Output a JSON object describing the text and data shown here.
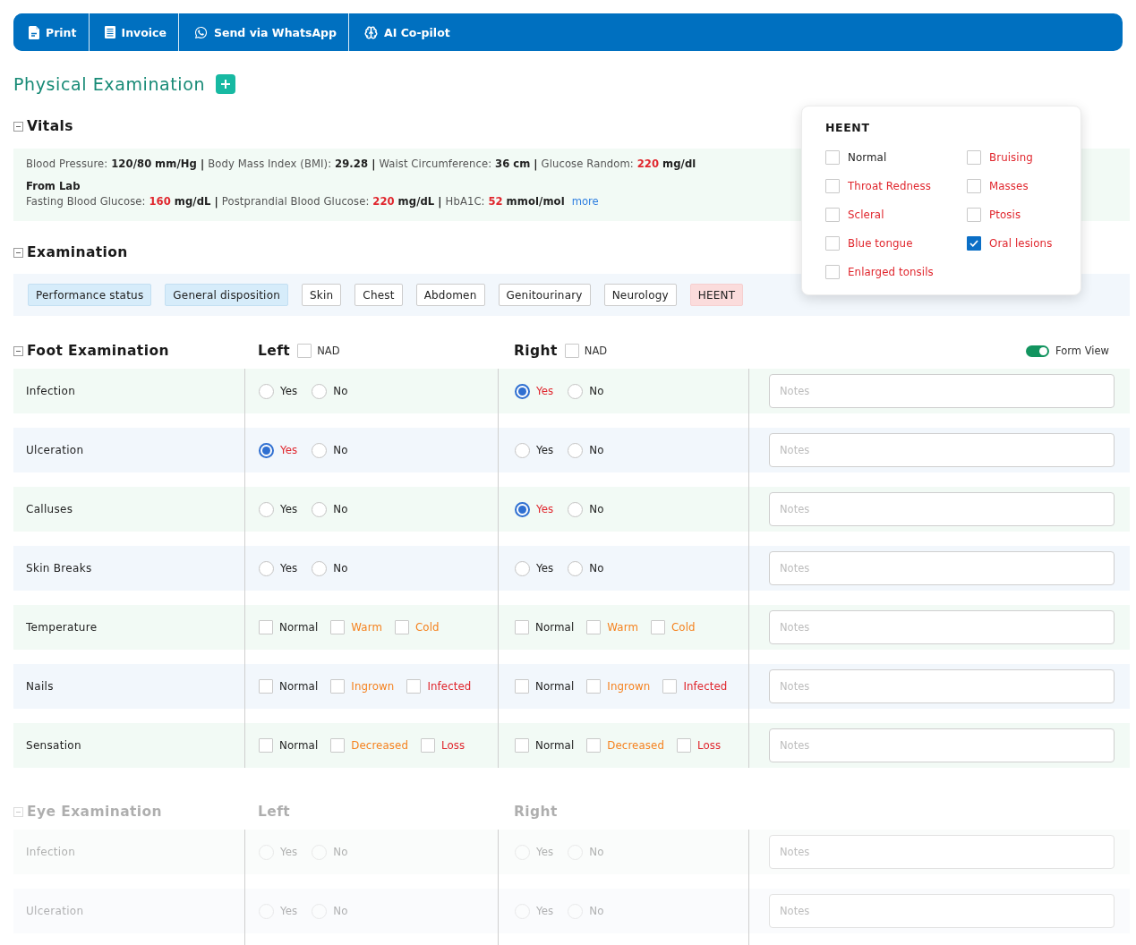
{
  "toolbar": {
    "buttons": [
      {
        "kind": "print",
        "label": "Print"
      },
      {
        "kind": "invoice",
        "label": "Invoice"
      },
      {
        "kind": "whatsapp",
        "label": "Send via WhatsApp"
      },
      {
        "kind": "copilot",
        "label": "AI Co-pilot"
      }
    ]
  },
  "page_title": "Physical Examination",
  "vitals": {
    "title": "Vitals",
    "expanded": true,
    "readings": [
      {
        "label": "Blood Pressure:",
        "value": "120/80",
        "unit": "mm/Hg",
        "abnormal": false,
        "separator": "|"
      },
      {
        "label": "Body Mass Index (BMI):",
        "value": "29.28",
        "abnormal": false,
        "separator": "|"
      },
      {
        "label": "Waist Circumference:",
        "value": "36",
        "unit": "cm",
        "abnormal": false,
        "separator": "|"
      },
      {
        "label": "Glucose Random:",
        "value": "220",
        "unit": "mg/dl",
        "abnormal": true
      }
    ],
    "lab_title": "From Lab",
    "lab_readings": [
      {
        "label": "Fasting Blood Glucose:",
        "value": "160",
        "unit": "mg/dL",
        "abnormal": true,
        "separator": "|"
      },
      {
        "label": "Postprandial Blood Glucose:",
        "value": "220",
        "unit": "mg/dL",
        "abnormal": true,
        "separator": "|"
      },
      {
        "label": "HbA1C:",
        "value": "52",
        "unit": "mmol/mol",
        "abnormal": true
      }
    ],
    "more_link": "more"
  },
  "examination": {
    "title": "Examination",
    "expanded": true,
    "tabs": [
      {
        "label": "Performance status",
        "filled": true,
        "selected": false
      },
      {
        "label": "General disposition",
        "filled": true,
        "selected": false
      },
      {
        "label": "Skin",
        "filled": false,
        "selected": false
      },
      {
        "label": "Chest",
        "filled": false,
        "selected": false
      },
      {
        "label": "Abdomen",
        "filled": false,
        "selected": false
      },
      {
        "label": "Genitourinary",
        "filled": false,
        "selected": false
      },
      {
        "label": "Neurology",
        "filled": false,
        "selected": false
      },
      {
        "label": "HEENT",
        "filled": false,
        "selected": true
      }
    ]
  },
  "heent_popup": {
    "title": "HEENT",
    "options": [
      {
        "label": "Normal",
        "color": "#222222",
        "checked": false
      },
      {
        "label": "Bruising",
        "color": "#e0262d",
        "checked": false
      },
      {
        "label": "Throat Redness",
        "color": "#e0262d",
        "checked": false
      },
      {
        "label": "Masses",
        "color": "#e0262d",
        "checked": false
      },
      {
        "label": "Scleral",
        "color": "#e0262d",
        "checked": false
      },
      {
        "label": "Ptosis",
        "color": "#e0262d",
        "checked": false
      },
      {
        "label": "Blue tongue",
        "color": "#e0262d",
        "checked": false
      },
      {
        "label": "Oral lesions",
        "color": "#e0262d",
        "checked": true
      },
      {
        "label": "Enlarged tonsils",
        "color": "#e0262d",
        "checked": false
      }
    ]
  },
  "foot_exam": {
    "title": "Foot Examination",
    "expanded": true,
    "disabled": false,
    "left": {
      "label": "Left",
      "nad": {
        "label": "NAD",
        "checked": false
      }
    },
    "right": {
      "label": "Right",
      "nad": {
        "label": "NAD",
        "checked": false
      }
    },
    "form_view": {
      "label": "Form View",
      "on": true
    },
    "rows": [
      {
        "label": "Infection",
        "kind": "radio",
        "left": [
          {
            "label": "Yes",
            "selected": false
          },
          {
            "label": "No",
            "selected": false
          }
        ],
        "right": [
          {
            "label": "Yes",
            "selected": true
          },
          {
            "label": "No",
            "selected": false
          }
        ],
        "notes": {
          "placeholder": "Notes"
        }
      },
      {
        "label": "Ulceration",
        "kind": "radio",
        "left": [
          {
            "label": "Yes",
            "selected": true
          },
          {
            "label": "No",
            "selected": false
          }
        ],
        "right": [
          {
            "label": "Yes",
            "selected": false
          },
          {
            "label": "No",
            "selected": false
          }
        ],
        "notes": {
          "placeholder": "Notes"
        }
      },
      {
        "label": "Calluses",
        "kind": "radio",
        "left": [
          {
            "label": "Yes",
            "selected": false
          },
          {
            "label": "No",
            "selected": false
          }
        ],
        "right": [
          {
            "label": "Yes",
            "selected": true
          },
          {
            "label": "No",
            "selected": false
          }
        ],
        "notes": {
          "placeholder": "Notes"
        }
      },
      {
        "label": "Skin Breaks",
        "kind": "radio",
        "left": [
          {
            "label": "Yes",
            "selected": false
          },
          {
            "label": "No",
            "selected": false
          }
        ],
        "right": [
          {
            "label": "Yes",
            "selected": false
          },
          {
            "label": "No",
            "selected": false
          }
        ],
        "notes": {
          "placeholder": "Notes"
        }
      },
      {
        "label": "Temperature",
        "kind": "checkbox",
        "left": [
          {
            "label": "Normal",
            "color": "#222222",
            "checked": false
          },
          {
            "label": "Warm",
            "color": "#f5821f",
            "checked": false
          },
          {
            "label": "Cold",
            "color": "#f5821f",
            "checked": false
          }
        ],
        "right": [
          {
            "label": "Normal",
            "color": "#222222",
            "checked": false
          },
          {
            "label": "Warm",
            "color": "#f5821f",
            "checked": false
          },
          {
            "label": "Cold",
            "color": "#f5821f",
            "checked": false
          }
        ],
        "notes": {
          "placeholder": "Notes"
        }
      },
      {
        "label": "Nails",
        "kind": "checkbox",
        "left": [
          {
            "label": "Normal",
            "color": "#222222",
            "checked": false
          },
          {
            "label": "Ingrown",
            "color": "#f5821f",
            "checked": false
          },
          {
            "label": "Infected",
            "color": "#e0262d",
            "checked": false
          }
        ],
        "right": [
          {
            "label": "Normal",
            "color": "#222222",
            "checked": false
          },
          {
            "label": "Ingrown",
            "color": "#f5821f",
            "checked": false
          },
          {
            "label": "Infected",
            "color": "#e0262d",
            "checked": false
          }
        ],
        "notes": {
          "placeholder": "Notes"
        }
      },
      {
        "label": "Sensation",
        "kind": "checkbox",
        "left": [
          {
            "label": "Normal",
            "color": "#222222",
            "checked": false
          },
          {
            "label": "Decreased",
            "color": "#f5821f",
            "checked": false
          },
          {
            "label": "Loss",
            "color": "#e0262d",
            "checked": false
          }
        ],
        "right": [
          {
            "label": "Normal",
            "color": "#222222",
            "checked": false
          },
          {
            "label": "Decreased",
            "color": "#f5821f",
            "checked": false
          },
          {
            "label": "Loss",
            "color": "#e0262d",
            "checked": false
          }
        ],
        "notes": {
          "placeholder": "Notes"
        }
      }
    ]
  },
  "eye_exam": {
    "title": "Eye Examination",
    "expanded": true,
    "disabled": true,
    "left": {
      "label": "Left"
    },
    "right": {
      "label": "Right"
    },
    "rows": [
      {
        "label": "Infection",
        "kind": "radio",
        "left": [
          {
            "label": "Yes",
            "selected": false
          },
          {
            "label": "No",
            "selected": false
          }
        ],
        "right": [
          {
            "label": "Yes",
            "selected": false
          },
          {
            "label": "No",
            "selected": false
          }
        ],
        "notes": {
          "placeholder": "Notes"
        }
      },
      {
        "label": "Ulceration",
        "kind": "radio",
        "left": [
          {
            "label": "Yes",
            "selected": false
          },
          {
            "label": "No",
            "selected": false
          }
        ],
        "right": [
          {
            "label": "Yes",
            "selected": false
          },
          {
            "label": "No",
            "selected": false
          }
        ],
        "notes": {
          "placeholder": "Notes"
        }
      }
    ]
  }
}
